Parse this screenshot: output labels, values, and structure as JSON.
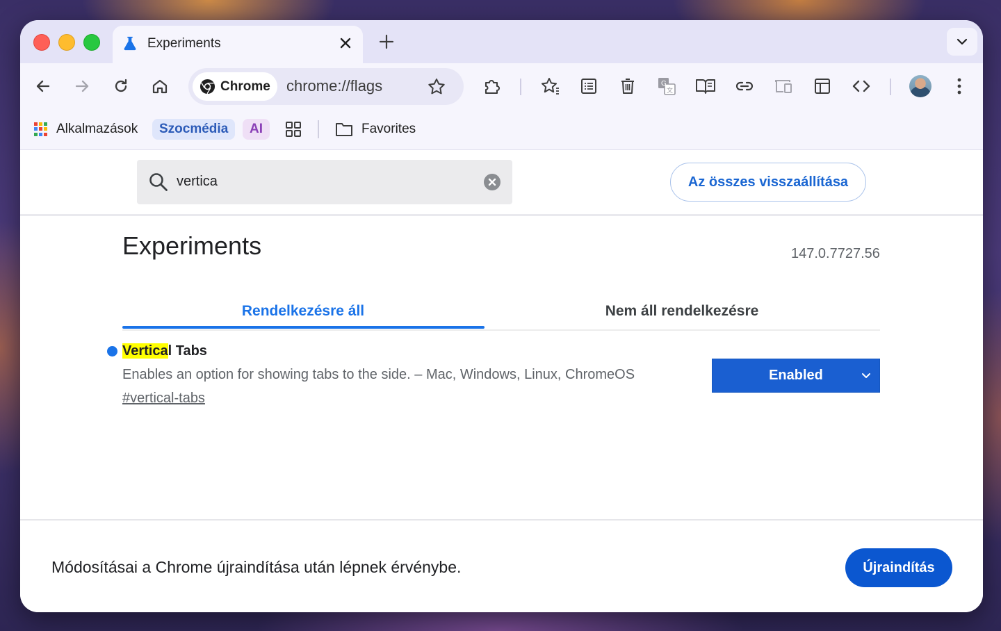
{
  "window": {
    "tab_title": "Experiments",
    "tab_icon": "flask-icon"
  },
  "toolbar": {
    "chip_label": "Chrome",
    "url": "chrome://flags",
    "icons": [
      "back-icon",
      "forward-icon",
      "reload-icon",
      "home-icon",
      "bookmark-star-icon",
      "extensions-icon",
      "bookmarks-manager-icon",
      "reading-list-icon",
      "delete-icon",
      "translate-icon",
      "reading-mode-icon",
      "copy-link-icon",
      "cast-icon",
      "tab-layout-icon",
      "devtools-icon",
      "profile-avatar",
      "menu-icon"
    ]
  },
  "bookmarks": {
    "apps_label": "Alkalmazások",
    "szocmedia_label": "Szocmédia",
    "ai_label": "AI",
    "favorites_label": "Favorites"
  },
  "flags": {
    "search_value": "vertica",
    "reset_all_label": "Az összes visszaállítása",
    "title": "Experiments",
    "version": "147.0.7727.56",
    "tab_available": "Rendelkezésre áll",
    "tab_unavailable": "Nem áll rendelkezésre",
    "experiment": {
      "name_highlight": "Vertica",
      "name_rest": "l Tabs",
      "description": "Enables an option for showing tabs to the side. – Mac, Windows, Linux, ChromeOS",
      "link": "#vertical-tabs",
      "state": "Enabled"
    }
  },
  "footer": {
    "message": "Módosításai a Chrome újraindítása után lépnek érvénybe.",
    "relaunch_label": "Újraindítás"
  },
  "colors": {
    "accent": "#1a73e8",
    "select_bg": "#1a5fd1",
    "relaunch_bg": "#0b57d0",
    "highlight": "#ffff00"
  }
}
